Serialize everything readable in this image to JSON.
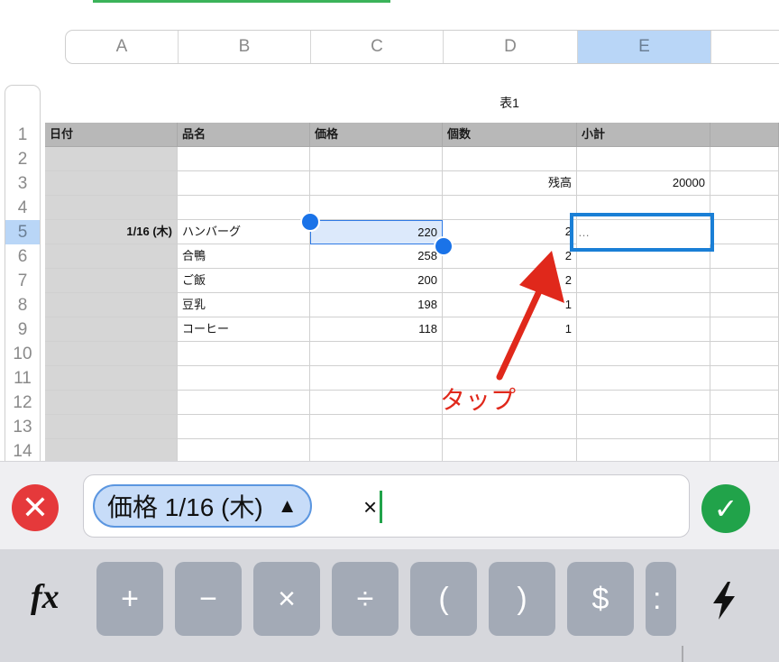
{
  "columns": [
    {
      "label": "A"
    },
    {
      "label": "B"
    },
    {
      "label": "C"
    },
    {
      "label": "D"
    },
    {
      "label": "E",
      "selected": true
    }
  ],
  "row_numbers": [
    "1",
    "2",
    "3",
    "4",
    "5",
    "6",
    "7",
    "8",
    "9",
    "10",
    "11",
    "12",
    "13",
    "14"
  ],
  "table_title": "表1",
  "header_row": [
    "日付",
    "品名",
    "価格",
    "個数",
    "小計"
  ],
  "rows": [
    [
      "",
      "",
      "",
      "",
      ""
    ],
    [
      "",
      "",
      "",
      "残高",
      "20000"
    ],
    [
      "",
      "",
      "",
      "",
      ""
    ],
    [
      "1/16 (木)",
      "ハンバーグ",
      "220",
      "2",
      "…"
    ],
    [
      "",
      "合鴨",
      "258",
      "2",
      ""
    ],
    [
      "",
      "ご飯",
      "200",
      "2",
      ""
    ],
    [
      "",
      "豆乳",
      "198",
      "1",
      ""
    ],
    [
      "",
      "コーヒー",
      "118",
      "1",
      ""
    ],
    [
      "",
      "",
      "",
      "",
      ""
    ],
    [
      "",
      "",
      "",
      "",
      ""
    ],
    [
      "",
      "",
      "",
      "",
      ""
    ],
    [
      "",
      "",
      "",
      "",
      ""
    ],
    [
      "",
      "",
      "",
      "",
      ""
    ]
  ],
  "annotation": {
    "text": "タップ",
    "color": "#e0281b"
  },
  "formula": {
    "token": "価格 1/16 (木)",
    "token_arrow": "▲",
    "operator": "×"
  },
  "buttons": {
    "cancel": "✕",
    "confirm": "✓"
  },
  "keyboard": {
    "fx": "fx",
    "keys": [
      "+",
      "−",
      "×",
      "÷",
      "(",
      ")",
      "$",
      ":"
    ]
  },
  "colors": {
    "accent_blue": "#1a73e8",
    "selection_fill": "#dce9fb",
    "cancel_red": "#e5393b",
    "confirm_green": "#21a34a",
    "annotation_red": "#e0281b"
  }
}
